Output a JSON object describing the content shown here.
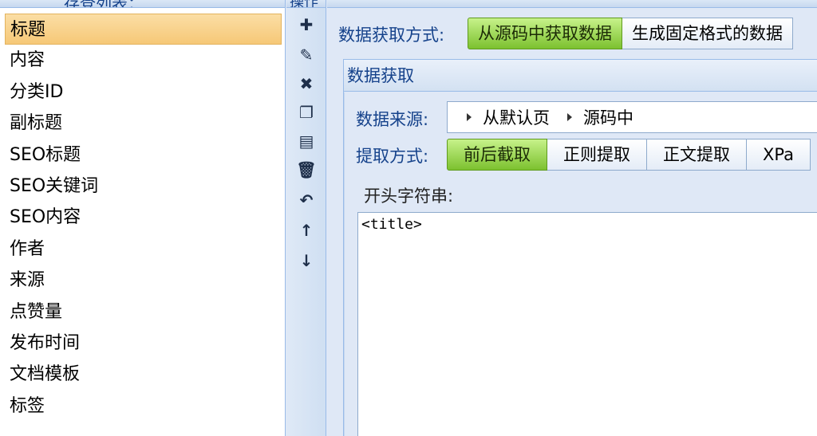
{
  "left_header": "存登列表：",
  "fields": [
    "标题",
    "内容",
    "分类ID",
    "副标题",
    "SEO标题",
    "SEO关键词",
    "SEO内容",
    "作者",
    "来源",
    "点赞量",
    "发布时间",
    "文档模板",
    "标签"
  ],
  "selected_field_index": 0,
  "toolbar": {
    "header": "操作",
    "buttons": [
      {
        "name": "add-icon",
        "glyph": "✚"
      },
      {
        "name": "edit-icon",
        "glyph": "✎"
      },
      {
        "name": "delete-icon",
        "glyph": "✖"
      },
      {
        "name": "copy-icon",
        "glyph": "❐"
      },
      {
        "name": "paste-icon",
        "glyph": "▤"
      },
      {
        "name": "trash-icon",
        "glyph": "🗑"
      },
      {
        "name": "undo-icon",
        "glyph": "↶"
      },
      {
        "name": "move-up-icon",
        "glyph": "↑"
      },
      {
        "name": "move-down-icon",
        "glyph": "↓"
      }
    ]
  },
  "fetch_method": {
    "label": "数据获取方式:",
    "options": [
      "从源码中获取数据",
      "生成固定格式的数据"
    ],
    "active": 0
  },
  "data_fetch_panel": {
    "title": "数据获取",
    "source_label": "数据来源:",
    "source_path": [
      "从默认页",
      "源码中"
    ],
    "extract_label": "提取方式:",
    "extract_options": [
      "前后截取",
      "正则提取",
      "正文提取",
      "XPa"
    ],
    "extract_active": 0,
    "start_string_label": "开头字符串:",
    "start_string_value": "<title>"
  },
  "colors": {
    "accent_green": "#7cc12f",
    "selected_row": "#f6c877",
    "panel_blue": "#dfe8f6",
    "label_blue": "#15428b"
  }
}
